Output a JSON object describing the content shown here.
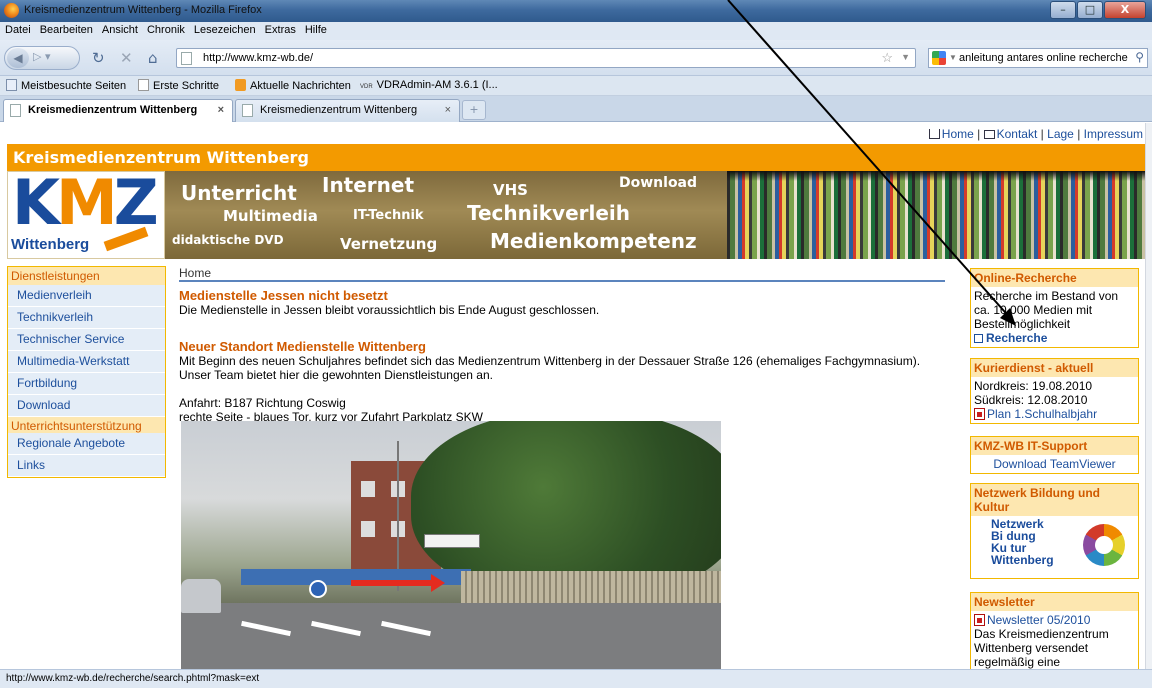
{
  "window": {
    "title": "Kreismedienzentrum Wittenberg - Mozilla Firefox",
    "controls": {
      "minimize": "–",
      "maximize": "□",
      "close": "X"
    }
  },
  "menu": [
    "Datei",
    "Bearbeiten",
    "Ansicht",
    "Chronik",
    "Lesezeichen",
    "Extras",
    "Hilfe"
  ],
  "navbar": {
    "url": "http://www.kmz-wb.de/",
    "search_query": "anleitung antares online recherche"
  },
  "bookmarks": [
    {
      "label": "Meistbesuchte Seiten",
      "icon": "page-icon"
    },
    {
      "label": "Erste Schritte",
      "icon": "page-icon"
    },
    {
      "label": "Aktuelle Nachrichten",
      "icon": "rss-icon"
    },
    {
      "label": "VDRAdmin-AM 3.6.1 (I...",
      "icon": "vdr-icon",
      "prefix": "VDR"
    }
  ],
  "tabs": [
    {
      "label": "Kreismedienzentrum Wittenberg",
      "active": true
    },
    {
      "label": "Kreismedienzentrum Wittenberg",
      "active": false
    }
  ],
  "toplinks": [
    "Home",
    "Kontakt",
    "Lage",
    "Impressum"
  ],
  "site": {
    "title": "Kreismedienzentrum Wittenberg",
    "logo_text": "Wittenberg"
  },
  "banner_words": [
    {
      "text": "Unterricht",
      "size": 20
    },
    {
      "text": "Internet",
      "size": 20
    },
    {
      "text": "VHS",
      "size": 15
    },
    {
      "text": "Download",
      "size": 14
    },
    {
      "text": "Multimedia",
      "size": 15
    },
    {
      "text": "IT-Technik",
      "size": 13
    },
    {
      "text": "Technikverleih",
      "size": 20
    },
    {
      "text": "didaktische DVD",
      "size": 12
    },
    {
      "text": "Vernetzung",
      "size": 15
    },
    {
      "text": "Medienkompetenz",
      "size": 20
    }
  ],
  "leftnav": {
    "header": "Dienstleistungen",
    "items": [
      "Medienverleih",
      "Technikverleih",
      "Technischer Service",
      "Multimedia-Werkstatt",
      "Fortbildung",
      "Download"
    ],
    "subheader": "Unterrichtsunterstützung",
    "items2": [
      "Regionale Angebote",
      "Links"
    ]
  },
  "content": {
    "breadcrumb": "Home",
    "h1": "Medienstelle Jessen nicht besetzt",
    "p1": "Die Medienstelle in Jessen bleibt voraussichtlich bis Ende August geschlossen.",
    "h2": "Neuer Standort Medienstelle Wittenberg",
    "p2": "Mit Beginn des neuen Schuljahres befindet sich das Medienzentrum Wittenberg in der Dessauer Straße 126 (ehemaliges Fachgymnasium). Unser Team bietet hier die gewohnten Dienstleistungen an.",
    "p3": "Anfahrt: B187 Richtung Coswig",
    "p4": "rechte Seite - blaues Tor, kurz vor Zufahrt Parkplatz SKW"
  },
  "sidebar": {
    "online": {
      "header": "Online-Recherche",
      "text": "Recherche im Bestand von ca. 10.000 Medien mit Bestellmöglichkeit",
      "link": "Recherche"
    },
    "kurier": {
      "header": "Kurierdienst - aktuell",
      "nord": "Nordkreis: 19.08.2010",
      "sued": "Südkreis: 12.08.2010",
      "plan": "Plan 1.Schulhalbjahr"
    },
    "itsupport": {
      "header": "KMZ-WB IT-Support",
      "link": "Download TeamViewer"
    },
    "netzwerk": {
      "header": "Netzwerk Bildung und Kultur",
      "logo": [
        "Netzwerk",
        "Bi  dung",
        "Ku  tur",
        "Wittenberg"
      ]
    },
    "newsletter": {
      "header": "Newsletter",
      "link": "Newsletter 05/2010",
      "text": "Das Kreismedienzentrum Wittenberg versendet regelmäßig eine"
    }
  },
  "statusbar": "http://www.kmz-wb.de/recherche/search.phtml?mask=ext",
  "colors": {
    "orange": "#f39a00",
    "nav_blue": "#1d4f9c",
    "heading_orange": "#d05a00"
  }
}
